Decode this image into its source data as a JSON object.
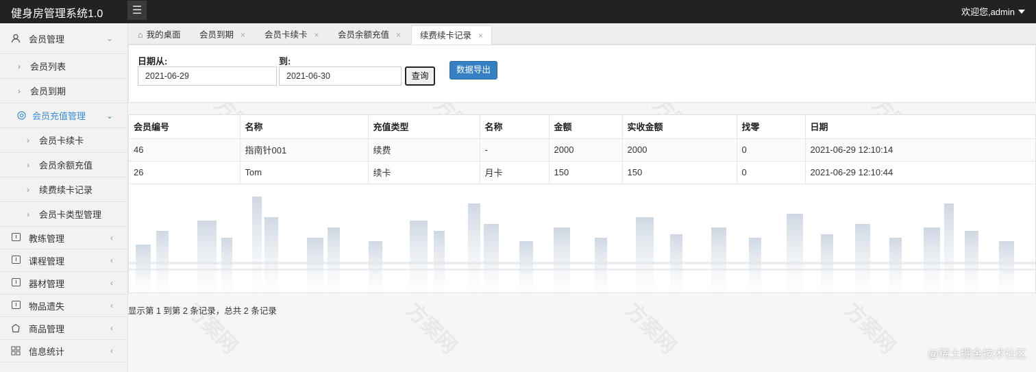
{
  "app": {
    "title": "健身房管理系统1.0",
    "user": "欢迎您,admin"
  },
  "sidebar": {
    "items": [
      {
        "label": "会员管理",
        "level": 0,
        "icon": "user-icon",
        "arrow": "down"
      },
      {
        "label": "会员列表",
        "level": 1
      },
      {
        "label": "会员到期",
        "level": 1
      },
      {
        "label": "会员充值管理",
        "level": 1,
        "icon": "recharge-icon",
        "arrow": "down",
        "active": true
      },
      {
        "label": "会员卡续卡",
        "level": 2
      },
      {
        "label": "会员余额充值",
        "level": 2
      },
      {
        "label": "续费续卡记录",
        "level": 2
      },
      {
        "label": "会员卡类型管理",
        "level": 2
      },
      {
        "label": "教练管理",
        "level": 0,
        "icon": "coach-icon",
        "arrow": "left"
      },
      {
        "label": "课程管理",
        "level": 0,
        "icon": "course-icon",
        "arrow": "left"
      },
      {
        "label": "器材管理",
        "level": 0,
        "icon": "equipment-icon",
        "arrow": "left"
      },
      {
        "label": "物品遗失",
        "level": 0,
        "icon": "lost-item-icon",
        "arrow": "left"
      },
      {
        "label": "商品管理",
        "level": 0,
        "icon": "goods-icon",
        "arrow": "left"
      },
      {
        "label": "信息统计",
        "level": 0,
        "icon": "grid-icon",
        "arrow": "left"
      }
    ]
  },
  "tabs": [
    {
      "label": "我的桌面",
      "icon": "home-icon",
      "closable": false
    },
    {
      "label": "会员到期",
      "closable": true
    },
    {
      "label": "会员卡续卡",
      "closable": true
    },
    {
      "label": "会员余额充值",
      "closable": true
    },
    {
      "label": "续费续卡记录",
      "closable": true,
      "active": true
    }
  ],
  "filter": {
    "from_label": "日期从:",
    "from_value": "2021-06-29",
    "to_label": "到:",
    "to_value": "2021-06-30",
    "query_label": "查询",
    "export_label": "数据导出"
  },
  "table": {
    "columns": [
      "会员编号",
      "名称",
      "充值类型",
      "名称",
      "金额",
      "实收金额",
      "找零",
      "日期"
    ],
    "rows": [
      [
        "46",
        "指南针001",
        "续费",
        "-",
        "2000",
        "2000",
        "0",
        "2021-06-29 12:10:14"
      ],
      [
        "26",
        "Tom",
        "续卡",
        "月卡",
        "150",
        "150",
        "0",
        "2021-06-29 12:10:44"
      ]
    ]
  },
  "pager": {
    "info": "显示第 1 到第 2 条记录，总共 2 条记录"
  },
  "credit": "@稀土掘金技术社区",
  "colors": {
    "topbar": "#222222",
    "accent": "#3b8ed8",
    "export_button": "#3580c4"
  }
}
